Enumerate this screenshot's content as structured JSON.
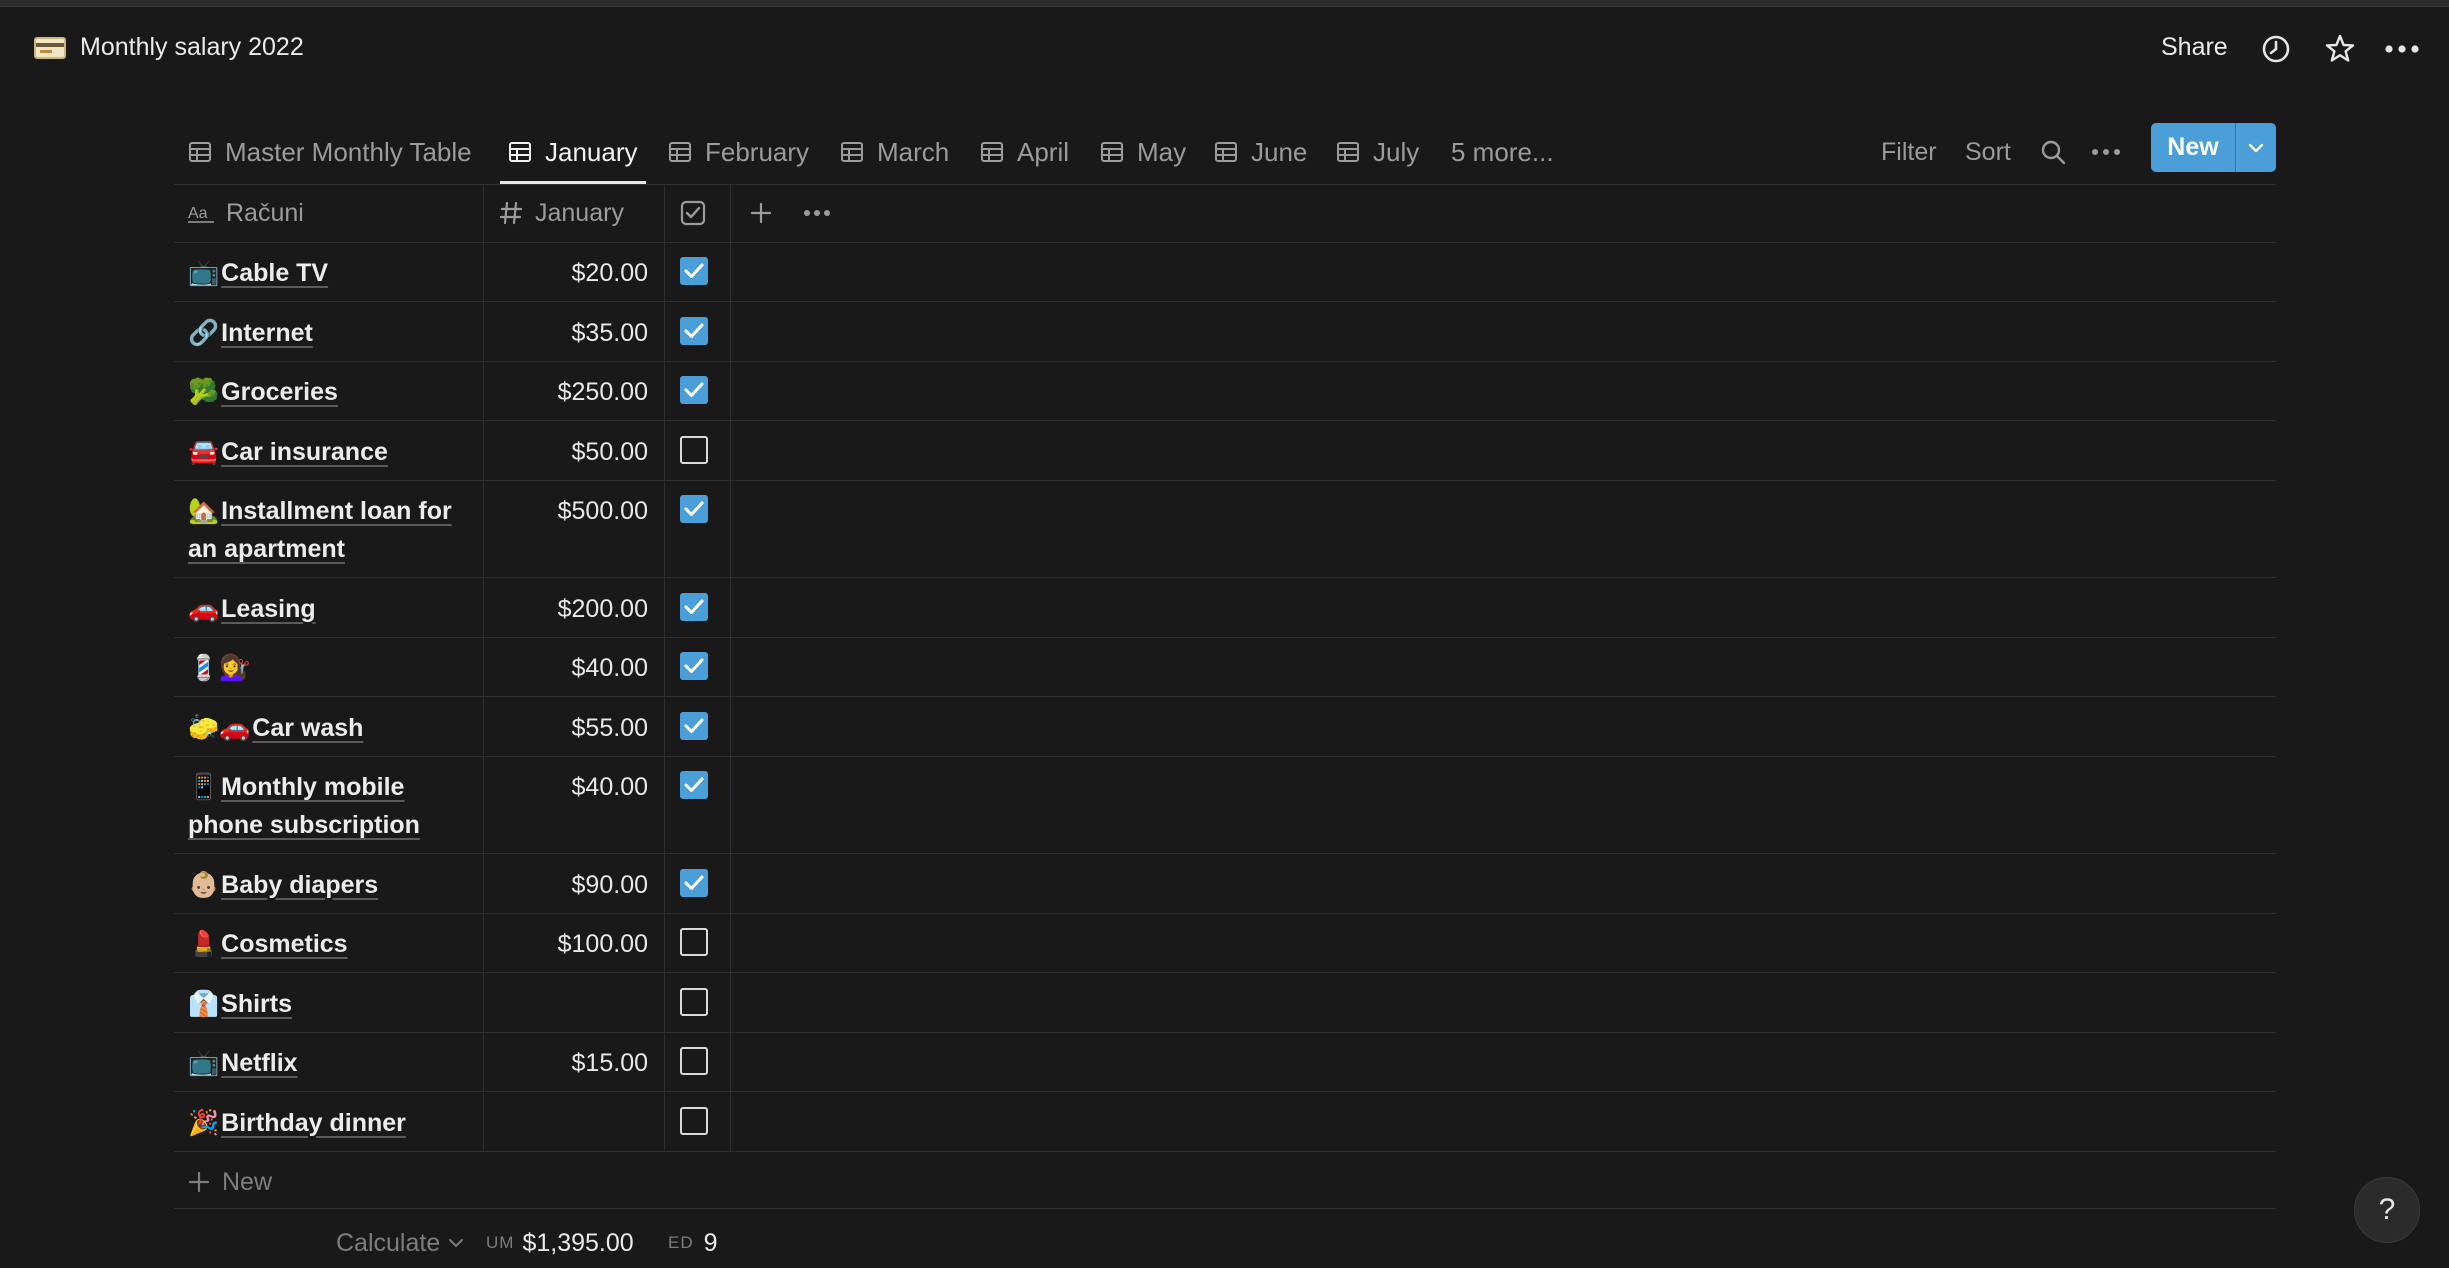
{
  "page": {
    "title": "Monthly salary 2022",
    "icon": "credit-card-icon"
  },
  "topbar": {
    "share_label": "Share",
    "icons": [
      "clock-icon",
      "star-icon",
      "more-icon"
    ]
  },
  "views": {
    "tabs": [
      {
        "label": "Master Monthly Table",
        "icon": "table-icon",
        "active": false
      },
      {
        "label": "January",
        "icon": "table-icon",
        "active": true
      },
      {
        "label": "February",
        "icon": "table-icon",
        "active": false
      },
      {
        "label": "March",
        "icon": "table-icon",
        "active": false
      },
      {
        "label": "April",
        "icon": "table-icon",
        "active": false
      },
      {
        "label": "May",
        "icon": "table-icon",
        "active": false
      },
      {
        "label": "June",
        "icon": "table-icon",
        "active": false
      },
      {
        "label": "July",
        "icon": "table-icon",
        "active": false
      }
    ],
    "more_label": "5 more...",
    "filter_label": "Filter",
    "sort_label": "Sort",
    "new_label": "New"
  },
  "table": {
    "columns": [
      {
        "label": "Računi",
        "icon": "text-property-icon"
      },
      {
        "label": "January",
        "icon": "number-property-icon"
      },
      {
        "label": "",
        "icon": "checkbox-property-icon"
      }
    ],
    "rows": [
      {
        "emoji": "📺",
        "name": "Cable TV",
        "amount": "$20.00",
        "checked": true
      },
      {
        "emoji": "🔗",
        "name": "Internet",
        "amount": "$35.00",
        "checked": true
      },
      {
        "emoji": "🥦",
        "name": "Groceries",
        "amount": "$250.00",
        "checked": true
      },
      {
        "emoji": "🚘",
        "name": "Car insurance",
        "amount": "$50.00",
        "checked": false
      },
      {
        "emoji": "🏡",
        "name": "Installment loan for an apartment",
        "amount": "$500.00",
        "checked": true
      },
      {
        "emoji": "🚗",
        "name": "Leasing",
        "amount": "$200.00",
        "checked": true
      },
      {
        "emoji": "💈💇‍♀️",
        "name": "",
        "amount": "$40.00",
        "checked": true
      },
      {
        "emoji": "🧽🚗",
        "name": "Car wash",
        "amount": "$55.00",
        "checked": true
      },
      {
        "emoji": "📱",
        "name": "Monthly mobile phone subscription",
        "amount": "$40.00",
        "checked": true
      },
      {
        "emoji": "👶🏼",
        "name": "Baby diapers",
        "amount": "$90.00",
        "checked": true
      },
      {
        "emoji": "💄",
        "name": "Cosmetics",
        "amount": "$100.00",
        "checked": false
      },
      {
        "emoji": "👔",
        "name": "Shirts",
        "amount": "",
        "checked": false
      },
      {
        "emoji": "📺",
        "name": "Netflix",
        "amount": "$15.00",
        "checked": false
      },
      {
        "emoji": "🎉",
        "name": "Birthday dinner",
        "amount": "",
        "checked": false
      }
    ],
    "new_row_label": "New"
  },
  "footer": {
    "calculate_label": "Calculate",
    "sum_prefix": "UM",
    "sum_value": "$1,395.00",
    "checked_prefix": "ED",
    "checked_value": "9"
  },
  "help_label": "?"
}
